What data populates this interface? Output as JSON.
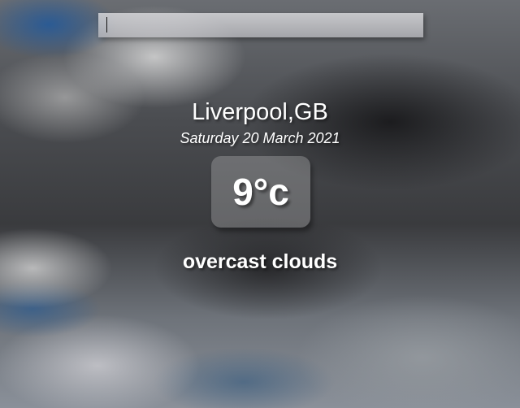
{
  "search": {
    "value": "",
    "placeholder": ""
  },
  "location": {
    "name": "Liverpool,GB",
    "date": "Saturday 20 March 2021"
  },
  "current": {
    "temperature": "9°c",
    "description": "overcast clouds"
  },
  "background": {
    "theme": "cloudy-sky"
  }
}
